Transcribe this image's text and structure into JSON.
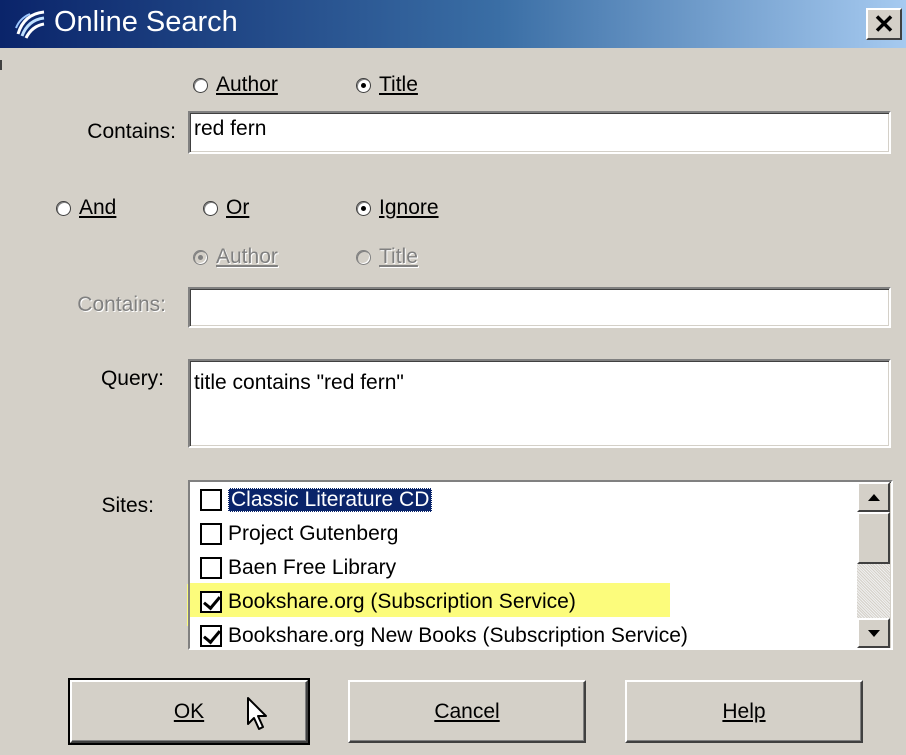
{
  "window": {
    "title": "Online Search",
    "close_label": "✕"
  },
  "search1": {
    "radio_author": "Author",
    "radio_title": "Title",
    "selected": "Title",
    "contains_label": "Contains:",
    "contains_value": "red fern"
  },
  "operator": {
    "and_label": "And",
    "or_label": "Or",
    "ignore_label": "Ignore",
    "selected": "Ignore"
  },
  "search2": {
    "radio_author": "Author",
    "radio_title": "Title",
    "selected": "Author",
    "contains_label": "Contains:",
    "contains_value": "",
    "disabled": true
  },
  "query": {
    "label": "Query:",
    "value": "title contains \"red fern\""
  },
  "sites": {
    "label": "Sites:",
    "items": [
      {
        "label": "Classic Literature CD",
        "checked": false,
        "selected": true
      },
      {
        "label": "Project Gutenberg",
        "checked": false
      },
      {
        "label": "Baen Free Library",
        "checked": false
      },
      {
        "label": "Bookshare.org (Subscription Service)",
        "checked": true,
        "highlighted": true
      },
      {
        "label": "Bookshare.org New Books (Subscription Service)",
        "checked": true
      }
    ]
  },
  "buttons": {
    "ok": "OK",
    "cancel": "Cancel",
    "help": "Help"
  },
  "colors": {
    "dialog_bg": "#d4d0c8",
    "title_gradient_start": "#0a246a",
    "title_gradient_end": "#a6caf0",
    "selection": "#0a246a",
    "highlight": "#fcfc7c"
  }
}
